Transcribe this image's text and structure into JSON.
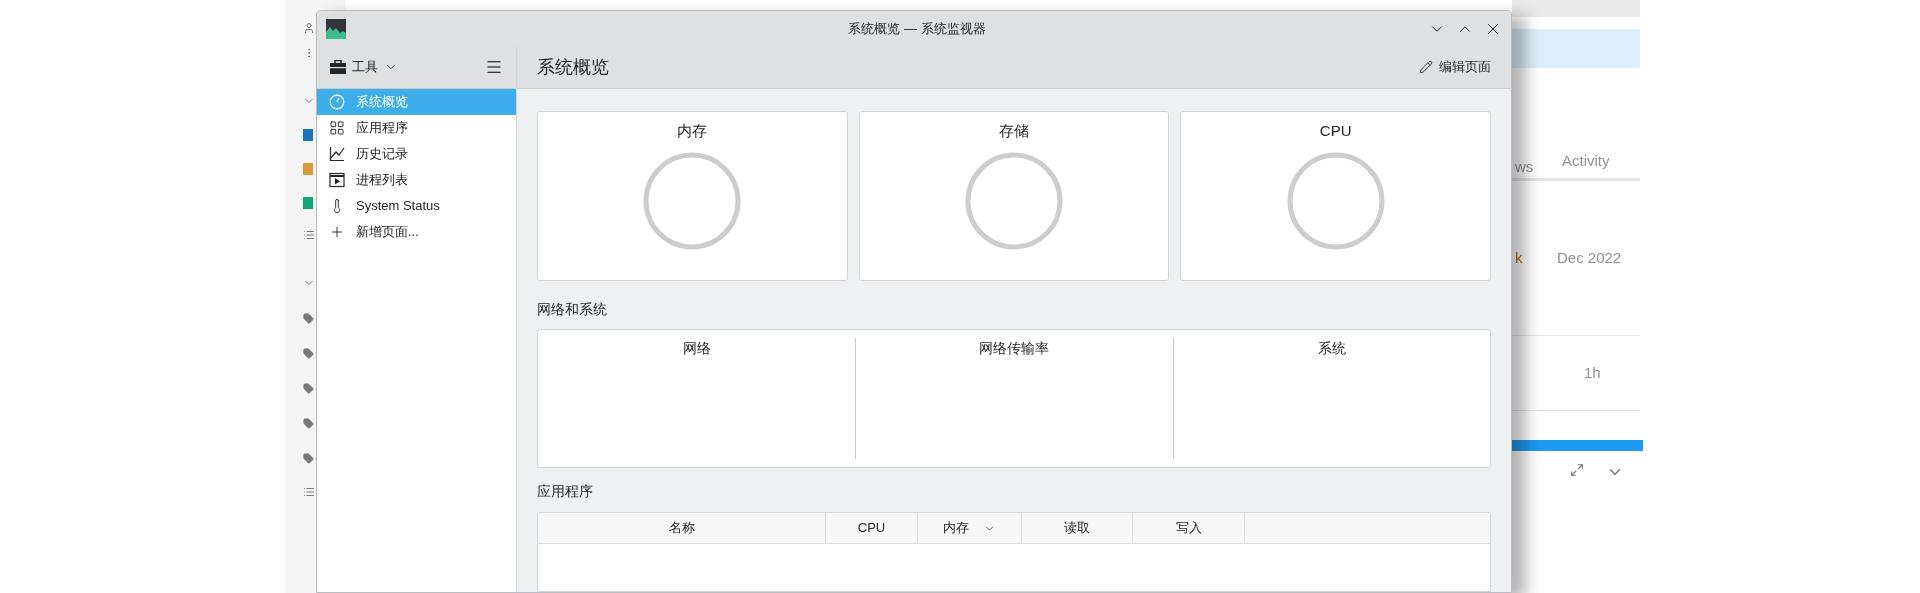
{
  "background_page": {
    "columns": [
      "ws",
      "Activity"
    ],
    "rows": [
      {
        "cell": "k",
        "activity": "Dec 2022"
      },
      {
        "activity": "1h"
      }
    ],
    "categories": [
      {
        "color": "#1a73c0"
      },
      {
        "color": "#d89b3a"
      },
      {
        "color": "#12a37a"
      }
    ]
  },
  "window": {
    "title": "系统概览 — 系统监视器"
  },
  "toolbar": {
    "menu": "工具",
    "page_title": "系统概览",
    "edit_button": "编辑页面"
  },
  "sidebar": {
    "items": [
      {
        "label": "系统概览",
        "selected": true
      },
      {
        "label": "应用程序",
        "selected": false
      },
      {
        "label": "历史记录",
        "selected": false
      },
      {
        "label": "进程列表",
        "selected": false
      },
      {
        "label": "System Status",
        "selected": false
      },
      {
        "label": "新增页面...",
        "selected": false
      }
    ]
  },
  "overview": {
    "cards": [
      {
        "title": "内存"
      },
      {
        "title": "存储"
      },
      {
        "title": "CPU"
      }
    ]
  },
  "network_section": {
    "title": "网络和系统",
    "columns": [
      "网络",
      "网络传输率",
      "系统"
    ]
  },
  "applications": {
    "title": "应用程序",
    "columns": [
      {
        "label": "名称",
        "sorted": false
      },
      {
        "label": "CPU",
        "sorted": false
      },
      {
        "label": "内存",
        "sorted": true
      },
      {
        "label": "读取",
        "sorted": false
      },
      {
        "label": "写入",
        "sorted": false
      }
    ]
  }
}
